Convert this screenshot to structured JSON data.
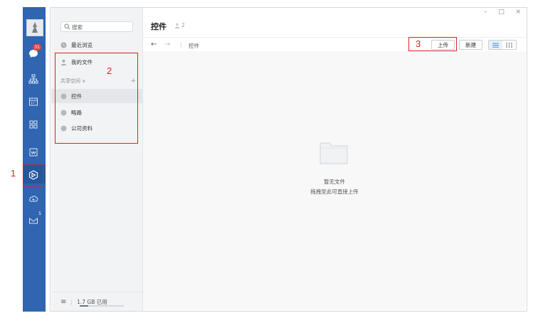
{
  "rail": {
    "badge_count": "31",
    "mail_count": "5",
    "icons": [
      "avatar",
      "chat-icon",
      "org-chart-icon",
      "calendar-icon",
      "apps-grid-icon",
      "doc-icon",
      "drive-icon",
      "cloud-icon",
      "mail-icon"
    ]
  },
  "sidebar": {
    "search_placeholder": "搜索",
    "recent": "最近浏览",
    "my_files": "我的文件",
    "shared_section": "共享空间 ∨",
    "shared_add": "+",
    "spaces": [
      "控件",
      "略路",
      "公司资料"
    ],
    "storage_used": "1.7 GB 已用",
    "storage_fraction": 0.2
  },
  "main": {
    "title": "控件",
    "member_count": "2",
    "breadcrumb": "控件",
    "upload_label": "上传",
    "new_label": "新建",
    "empty_title": "暂无文件",
    "empty_hint": "拖拽至此可直接上传"
  },
  "window_controls": [
    "–",
    "□",
    "×"
  ],
  "annotations": [
    "1",
    "2",
    "3"
  ],
  "colors": {
    "rail": "#2f65b1",
    "accent": "#3a76c9",
    "annotation": "#e02020"
  }
}
